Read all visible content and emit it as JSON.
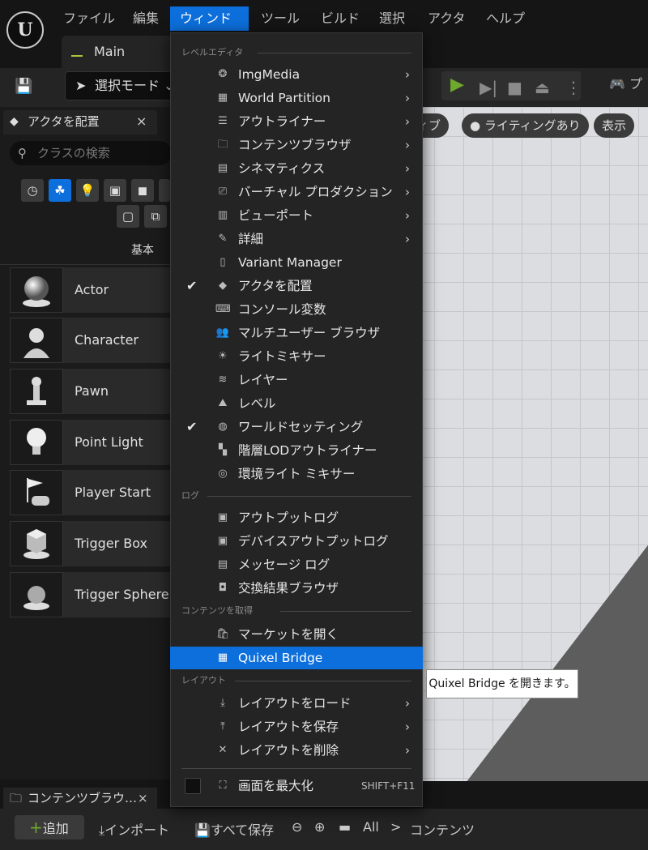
{
  "menubar": {
    "items": [
      "ファイル",
      "編集",
      "ウィンドウ",
      "ツール",
      "ビルド",
      "選択",
      "アクタ",
      "ヘルプ"
    ],
    "active_index": 2
  },
  "main_tab": {
    "label": "Main"
  },
  "toolbar": {
    "mode_label": "選択モード",
    "platform_label": "プ"
  },
  "place_panel": {
    "tab_label": "アクタを配置",
    "close": "×",
    "search_placeholder": "クラスの検索",
    "category_label": "基本",
    "actors": [
      {
        "label": "Actor",
        "icon": "sphere-icon"
      },
      {
        "label": "Character",
        "icon": "character-icon"
      },
      {
        "label": "Pawn",
        "icon": "pawn-icon"
      },
      {
        "label": "Point Light",
        "icon": "light-bulb-icon"
      },
      {
        "label": "Player Start",
        "icon": "player-start-icon"
      },
      {
        "label": "Trigger Box",
        "icon": "trigger-box-icon"
      },
      {
        "label": "Trigger Sphere",
        "icon": "trigger-sphere-icon"
      }
    ]
  },
  "viewport": {
    "chips": [
      "ィブ",
      "ライティングあり",
      "表示"
    ]
  },
  "window_menu": {
    "sections": {
      "level_editor": "レベルエディタ",
      "log": "ログ",
      "get_content": "コンテンツを取得",
      "layout": "レイアウト"
    },
    "level_editor_items": [
      {
        "label": "ImgMedia",
        "submenu": true,
        "checked": false,
        "icon": "media-icon"
      },
      {
        "label": "World Partition",
        "submenu": true,
        "checked": false,
        "icon": "grid-icon"
      },
      {
        "label": "アウトライナー",
        "submenu": true,
        "checked": false,
        "icon": "outliner-icon"
      },
      {
        "label": "コンテンツブラウザ",
        "submenu": true,
        "checked": false,
        "icon": "folder-search-icon"
      },
      {
        "label": "シネマティクス",
        "submenu": true,
        "checked": false,
        "icon": "clapper-icon"
      },
      {
        "label": "バーチャル プロダクション",
        "submenu": true,
        "checked": false,
        "icon": "camera-icon"
      },
      {
        "label": "ビューポート",
        "submenu": true,
        "checked": false,
        "icon": "viewport-icon"
      },
      {
        "label": "詳細",
        "submenu": true,
        "checked": false,
        "icon": "pencil-icon"
      },
      {
        "label": "Variant Manager",
        "submenu": false,
        "checked": false,
        "icon": "book-icon"
      },
      {
        "label": "アクタを配置",
        "submenu": false,
        "checked": true,
        "icon": "place-actor-icon"
      },
      {
        "label": "コンソール変数",
        "submenu": false,
        "checked": false,
        "icon": "console-icon"
      },
      {
        "label": "マルチユーザー ブラウザ",
        "submenu": false,
        "checked": false,
        "icon": "users-icon"
      },
      {
        "label": "ライトミキサー",
        "submenu": false,
        "checked": false,
        "icon": "sun-icon"
      },
      {
        "label": "レイヤー",
        "submenu": false,
        "checked": false,
        "icon": "layers-icon"
      },
      {
        "label": "レベル",
        "submenu": false,
        "checked": false,
        "icon": "level-icon"
      },
      {
        "label": "ワールドセッティング",
        "submenu": false,
        "checked": true,
        "icon": "globe-icon"
      },
      {
        "label": "階層LODアウトライナー",
        "submenu": false,
        "checked": false,
        "icon": "hlod-icon"
      },
      {
        "label": "環境ライト ミキサー",
        "submenu": false,
        "checked": false,
        "icon": "env-light-icon"
      }
    ],
    "log_items": [
      {
        "label": "アウトプットログ",
        "icon": "terminal-icon"
      },
      {
        "label": "デバイスアウトプットログ",
        "icon": "device-log-icon"
      },
      {
        "label": "メッセージ ログ",
        "icon": "message-icon"
      },
      {
        "label": "交換結果ブラウザ",
        "icon": "chat-icon"
      }
    ],
    "content_items": [
      {
        "label": "マーケットを開く",
        "icon": "market-icon"
      },
      {
        "label": "Quixel Bridge",
        "icon": "bridge-icon",
        "highlighted": true
      }
    ],
    "layout_items": [
      {
        "label": "レイアウトをロード",
        "submenu": true,
        "icon": "layout-load-icon"
      },
      {
        "label": "レイアウトを保存",
        "submenu": true,
        "icon": "layout-save-icon"
      },
      {
        "label": "レイアウトを削除",
        "submenu": true,
        "icon": "layout-delete-icon"
      }
    ],
    "maximize": {
      "label": "画面を最大化",
      "shortcut": "SHIFT+F11"
    }
  },
  "tooltip": {
    "text": "Quixel Bridge を開きます。"
  },
  "content_browser": {
    "tab_label": "コンテンツブラウ…",
    "close": "×",
    "add_label": "追加",
    "import_label": "インポート",
    "save_all_label": "すべて保存",
    "path_all": "All",
    "path_sep": ">",
    "path_content": "コンテンツ"
  },
  "colors": {
    "accent": "#0d6fdc",
    "play": "#6ea82c"
  }
}
